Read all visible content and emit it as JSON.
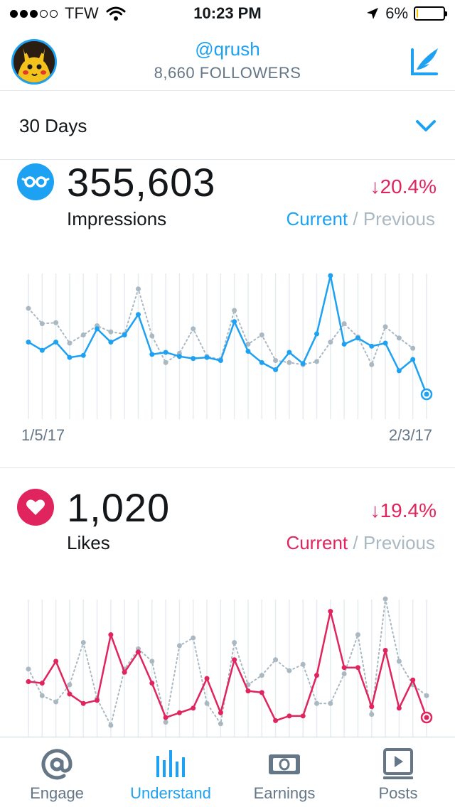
{
  "status_bar": {
    "carrier": "TFW",
    "time": "10:23 PM",
    "battery": "6%",
    "battery_level": 0.06,
    "signal_bars": 3,
    "icons": [
      "signal-dots-icon",
      "wifi-icon",
      "location-arrow-icon",
      "battery-icon"
    ]
  },
  "header": {
    "handle": "@qrush",
    "followers": "8,660 FOLLOWERS",
    "avatar_icon": "avatar",
    "compose_icon": "compose-icon"
  },
  "range": {
    "label": "30 Days",
    "icon": "chevron-down-icon"
  },
  "colors": {
    "accent": "#1da1f2",
    "likes": "#e0245e",
    "previous": "#aab8c2",
    "text": "#14171a",
    "muted": "#657786"
  },
  "impressions": {
    "icon": "glasses-icon",
    "value": "355,603",
    "label": "Impressions",
    "change": "20.4%",
    "change_direction": "down",
    "legend_current": "Current",
    "legend_sep": "/",
    "legend_previous": "Previous",
    "x_start": "1/5/17",
    "x_end": "2/3/17"
  },
  "likes": {
    "icon": "heart-icon",
    "value": "1,020",
    "label": "Likes",
    "change": "19.4%",
    "change_direction": "down",
    "legend_current": "Current",
    "legend_sep": "/",
    "legend_previous": "Previous"
  },
  "chart_data": [
    {
      "type": "line",
      "x_start": "1/5/17",
      "x_end": "2/3/17",
      "series": [
        {
          "name": "Current",
          "values": [
            12000,
            11200,
            12000,
            10500,
            10700,
            13300,
            12000,
            12700,
            14700,
            10800,
            11000,
            10600,
            10400,
            10500,
            10200,
            14000,
            11100,
            10000,
            9300,
            11000,
            9900,
            12800,
            18500,
            11800,
            12400,
            11600,
            11900,
            9200,
            10300,
            6900
          ]
        },
        {
          "name": "Previous",
          "values": [
            15300,
            13800,
            13900,
            11900,
            12700,
            13600,
            13000,
            12800,
            17200,
            12600,
            10000,
            10900,
            13300,
            10600,
            10300,
            15100,
            11800,
            12700,
            10200,
            10000,
            9800,
            10100,
            12000,
            13800,
            12500,
            9800,
            13500,
            12400,
            11400
          ]
        }
      ]
    },
    {
      "type": "line",
      "series": [
        {
          "name": "Current",
          "values": [
            35,
            34,
            48,
            27,
            21,
            23,
            65,
            41,
            54,
            34,
            12,
            15,
            18,
            37,
            15,
            49,
            29,
            28,
            10,
            13,
            13,
            39,
            80,
            44,
            44,
            19,
            55,
            18,
            36,
            12
          ]
        },
        {
          "name": "Previous",
          "values": [
            43,
            26,
            22,
            33,
            60,
            24,
            7,
            43,
            56,
            48,
            9,
            58,
            63,
            21,
            8,
            60,
            33,
            39,
            49,
            42,
            46,
            21,
            21,
            40,
            65,
            14,
            88,
            48,
            33,
            26
          ]
        }
      ]
    }
  ],
  "tabs": [
    {
      "label": "Engage",
      "icon": "at-icon",
      "active": false
    },
    {
      "label": "Understand",
      "icon": "bar-chart-icon",
      "active": true
    },
    {
      "label": "Earnings",
      "icon": "money-icon",
      "active": false
    },
    {
      "label": "Posts",
      "icon": "video-icon",
      "active": false
    }
  ]
}
